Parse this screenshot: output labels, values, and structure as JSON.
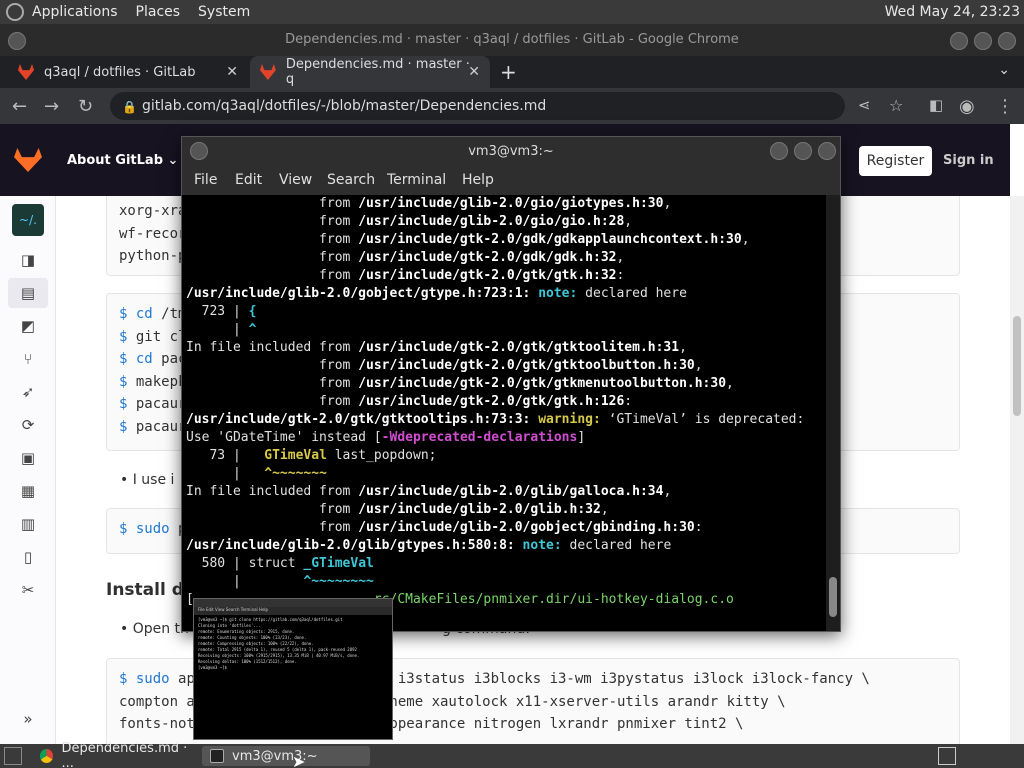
{
  "top_panel": {
    "menus": [
      "Applications",
      "Places",
      "System"
    ],
    "clock": "Wed May 24, 23:23"
  },
  "chrome": {
    "window_title": "Dependencies.md · master · q3aql / dotfiles · GitLab - Google Chrome",
    "tabs": [
      {
        "label": "q3aql / dotfiles · GitLab"
      },
      {
        "label": "Dependencies.md · master · q"
      }
    ],
    "url": "gitlab.com/q3aql/dotfiles/-/blob/master/Dependencies.md"
  },
  "gitlab": {
    "about": "About GitLab",
    "register": "Register",
    "sign_in": "Sign in",
    "project_avatar": "~/.",
    "block1": [
      "xorg-xra",
      "wf-recor",
      "python-p"
    ],
    "block2": [
      {
        "prompt": "$",
        "cmd": "cd",
        "rest": " /tm"
      },
      {
        "prompt": "$",
        "cmd": "",
        "rest": " git cl"
      },
      {
        "prompt": "$",
        "cmd": "cd",
        "rest": " pac"
      },
      {
        "prompt": "$",
        "cmd": "",
        "rest": " makepk"
      },
      {
        "prompt": "$",
        "cmd": "",
        "rest": " pacaur"
      },
      {
        "prompt": "$",
        "cmd": "",
        "rest": " pacaur"
      }
    ],
    "bullet1": "I use i",
    "block3": {
      "prompt": "$",
      "cmd": "sudo",
      "rest": " p"
    },
    "heading_install": "Install de",
    "bullet2_left": "Open th",
    "bullet2_right": "g command:",
    "block4": [
      {
        "prompt": "$",
        "cmd": "sudo",
        "left": " ap",
        "right": "3 i3status i3blocks i3-wm i3pystatus i3lock i3lock-fancy \\"
      },
      {
        "prompt": "",
        "cmd": "",
        "left": "compton a",
        "right": "theme xautolock x11-xserver-utils arandr kitty \\"
      },
      {
        "prompt": "",
        "cmd": "",
        "left": "fonts-not",
        "right": "appearance nitrogen lxrandr pnmixer tint2 \\"
      }
    ]
  },
  "terminal": {
    "title": "vm3@vm3:~",
    "menus": [
      "File",
      "Edit",
      "View",
      "Search",
      "Terminal",
      "Help"
    ],
    "lines": [
      {
        "pre": "                 from ",
        "path": "/usr/include/glib-2.0/gio/giotypes.h:30",
        "post": ","
      },
      {
        "pre": "                 from ",
        "path": "/usr/include/glib-2.0/gio/gio.h:28",
        "post": ","
      },
      {
        "pre": "                 from ",
        "path": "/usr/include/gtk-2.0/gdk/gdkapplaunchcontext.h:30",
        "post": ","
      },
      {
        "pre": "                 from ",
        "path": "/usr/include/gtk-2.0/gdk/gdk.h:32",
        "post": ","
      },
      {
        "pre": "                 from ",
        "path": "/usr/include/gtk-2.0/gtk/gtk.h:32",
        "post": ":"
      },
      {
        "pre": "",
        "path": "/usr/include/glib-2.0/gobject/gtype.h:723:1:",
        "post": "",
        "tag": " note:",
        "msg": " declared here"
      },
      {
        "pre": "  723 | ",
        "path": "",
        "post": "",
        "hl": "{"
      },
      {
        "pre": "      | ",
        "path": "",
        "post": "",
        "hl": "^"
      },
      {
        "pre": "In file included from ",
        "path": "/usr/include/gtk-2.0/gtk/gtktoolitem.h:31",
        "post": ","
      },
      {
        "pre": "                 from ",
        "path": "/usr/include/gtk-2.0/gtk/gtktoolbutton.h:30",
        "post": ","
      },
      {
        "pre": "                 from ",
        "path": "/usr/include/gtk-2.0/gtk/gtkmenutoolbutton.h:30",
        "post": ","
      },
      {
        "pre": "                 from ",
        "path": "/usr/include/gtk-2.0/gtk/gtk.h:126",
        "post": ":"
      },
      {
        "pre": "",
        "path": "/usr/include/gtk-2.0/gtk/gtktooltips.h:73:3:",
        "post": "",
        "wtag": " warning:",
        "msg": " ‘GTimeVal’ is deprecated:"
      },
      {
        "pre": "Use 'GDateTime' instead [",
        "path": "",
        "post": "]",
        "flag": "-Wdeprecated-declarations"
      },
      {
        "pre": "   73 |   ",
        "path": "",
        "post": " last_popdown;",
        "whl": "GTimeVal"
      },
      {
        "pre": "      |   ",
        "path": "",
        "post": "",
        "whl": "^~~~~~~~"
      },
      {
        "pre": "In file included from ",
        "path": "/usr/include/glib-2.0/glib/galloca.h:34",
        "post": ","
      },
      {
        "pre": "                 from ",
        "path": "/usr/include/glib-2.0/glib.h:32",
        "post": ","
      },
      {
        "pre": "                 from ",
        "path": "/usr/include/glib-2.0/gobject/gbinding.h:30",
        "post": ":"
      },
      {
        "pre": "",
        "path": "/usr/include/glib-2.0/glib/gtypes.h:580:8:",
        "post": "",
        "tag": " note:",
        "msg": " declared here"
      },
      {
        "pre": "  580 | struct ",
        "path": "",
        "post": "",
        "nhl": "_GTimeVal"
      },
      {
        "pre": "      |        ",
        "path": "",
        "post": "",
        "nhl": "^~~~~~~~~"
      },
      {
        "pre": "[",
        "path": "",
        "post": "",
        "green": "                       rc/CMakeFiles/pnmixer.dir/ui-hotkey-dialog.c.o"
      }
    ]
  },
  "mini_preview": {
    "menu": "File  Edit  View  Search  Terminal  Help",
    "lines": [
      "[vm3@vm3 ~]$ git clone https://gitlab.com/q3aql/dotfiles.git",
      "Cloning into 'dotfiles'...",
      "remote: Enumerating objects: 2915, done.",
      "remote: Counting objects: 100% (23/23), done.",
      "remote: Compressing objects: 100% (22/22), done.",
      "remote: Total 2915 (delta 1), reused 5 (delta 1), pack-reused 2892",
      "Receiving objects: 100% (2915/2915), 13.35 MiB | 40.97 MiB/s, done.",
      "Resolving deltas: 100% (1512/1512), done.",
      "[vm3@vm3 ~]$"
    ]
  },
  "taskbar": {
    "items": [
      {
        "label": "Dependencies.md · ..."
      },
      {
        "label": "vm3@vm3:~"
      }
    ]
  }
}
